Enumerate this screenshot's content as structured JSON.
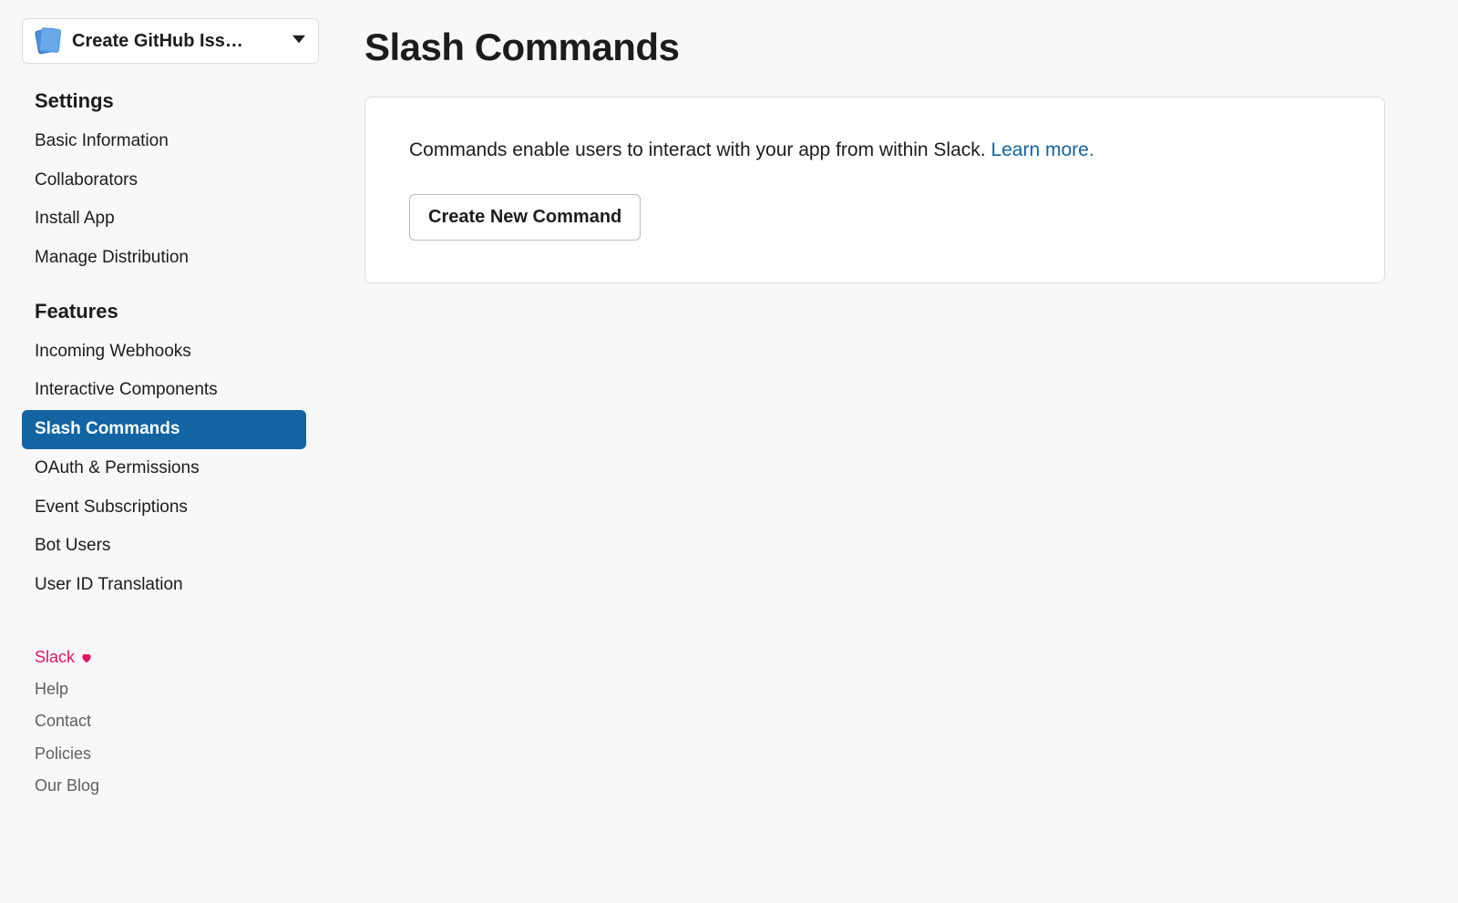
{
  "app_selector": {
    "name": "Create GitHub Iss…"
  },
  "sidebar": {
    "sections": [
      {
        "title": "Settings",
        "items": [
          {
            "label": "Basic Information",
            "active": false
          },
          {
            "label": "Collaborators",
            "active": false
          },
          {
            "label": "Install App",
            "active": false
          },
          {
            "label": "Manage Distribution",
            "active": false
          }
        ]
      },
      {
        "title": "Features",
        "items": [
          {
            "label": "Incoming Webhooks",
            "active": false
          },
          {
            "label": "Interactive Components",
            "active": false
          },
          {
            "label": "Slash Commands",
            "active": true
          },
          {
            "label": "OAuth & Permissions",
            "active": false
          },
          {
            "label": "Event Subscriptions",
            "active": false
          },
          {
            "label": "Bot Users",
            "active": false
          },
          {
            "label": "User ID Translation",
            "active": false
          }
        ]
      }
    ],
    "footer": [
      {
        "label": "Slack",
        "brand": true
      },
      {
        "label": "Help",
        "brand": false
      },
      {
        "label": "Contact",
        "brand": false
      },
      {
        "label": "Policies",
        "brand": false
      },
      {
        "label": "Our Blog",
        "brand": false
      }
    ]
  },
  "main": {
    "title": "Slash Commands",
    "card": {
      "description": "Commands enable users to interact with your app from within Slack. ",
      "learn_more": "Learn more.",
      "button": "Create New Command"
    }
  }
}
